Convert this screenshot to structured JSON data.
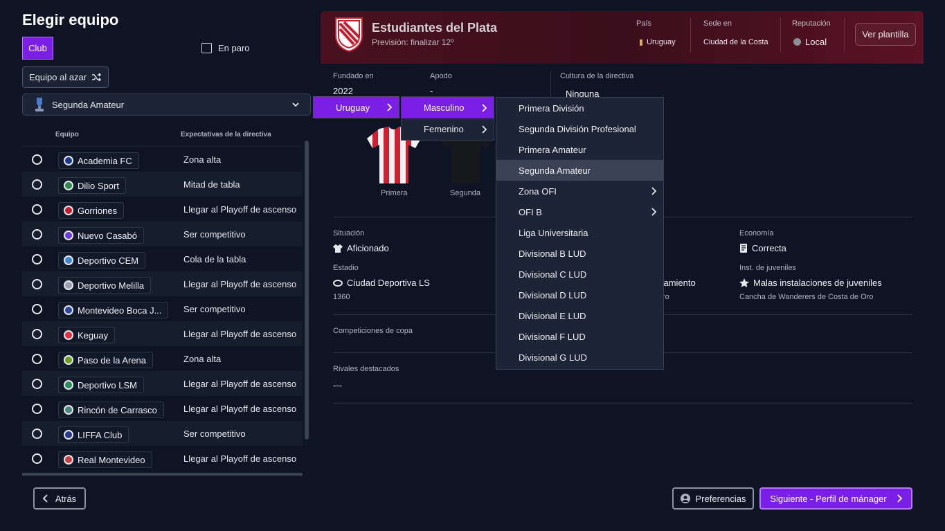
{
  "left": {
    "title": "Elegir equipo",
    "club_tab": "Club",
    "en_paro": "En paro",
    "random_btn": "Equipo al azar",
    "league": "Segunda Amateur",
    "col_team": "Equipo",
    "col_expect": "Expectativas de la directiva",
    "rows": [
      {
        "name": "Academia FC",
        "expect": "Zona alta",
        "color": "#1a3a8a"
      },
      {
        "name": "Dilio Sport",
        "expect": "Mitad de tabla",
        "color": "#2e8a4a"
      },
      {
        "name": "Gorriones",
        "expect": "Llegar al Playoff de ascenso",
        "color": "#c02030"
      },
      {
        "name": "Nuevo Casabó",
        "expect": "Ser competitivo",
        "color": "#6a3adc"
      },
      {
        "name": "Deportivo CEM",
        "expect": "Cola de la tabla",
        "color": "#3a8ad8"
      },
      {
        "name": "Deportivo Melilla",
        "expect": "Llegar al Playoff de ascenso",
        "color": "#9aa0b0"
      },
      {
        "name": "Montevideo Boca J...",
        "expect": "Ser competitivo",
        "color": "#2a4aa8"
      },
      {
        "name": "Keguay",
        "expect": "Llegar al Playoff de ascenso",
        "color": "#e03040"
      },
      {
        "name": "Paso de la Arena",
        "expect": "Zona alta",
        "color": "#6aa020"
      },
      {
        "name": "Deportivo LSM",
        "expect": "Llegar al Playoff de ascenso",
        "color": "#2a8a5a"
      },
      {
        "name": "Rincón de Carrasco",
        "expect": "Llegar al Playoff de ascenso",
        "color": "#4a8a7a"
      },
      {
        "name": "LIFFA Club",
        "expect": "Ser competitivo",
        "color": "#2a3a8a"
      },
      {
        "name": "Real Montevideo",
        "expect": "Llegar al Playoff de ascenso",
        "color": "#c84040"
      }
    ],
    "back": "Atrás"
  },
  "header": {
    "club_name": "Estudiantes del Plata",
    "prevision": "Previsión: finalizar 12º",
    "pais_label": "País",
    "pais": "Uruguay",
    "sede_label": "Sede en",
    "sede": "Ciudad de la Costa",
    "rep_label": "Reputación",
    "rep": "Local",
    "ver_plantilla": "Ver plantilla"
  },
  "details": {
    "fundado_label": "Fundado en",
    "fundado": "2022",
    "apodo_label": "Apodo",
    "apodo": "-",
    "cultura_label": "Cultura de la directiva",
    "cultura": "Ninguna",
    "shirt1": "Primera",
    "shirt2": "Segunda",
    "situacion_label": "Situación",
    "situacion": "Aficionado",
    "economia_label": "Economía",
    "economia": "Correcta",
    "estadio_label": "Estadio",
    "estadio": "Ciudad Deportiva LS",
    "capacidad": "1360",
    "entreno_partial": "enamiento",
    "entreno_sub_partial": "ro",
    "juveniles_label": "Inst. de juveniles",
    "juveniles": "Malas instalaciones de juveniles",
    "juveniles_sub": "Cancha de Wanderers de Costa de Oro",
    "copa_label": "Competiciones de copa",
    "rivales_label": "Rivales destacados",
    "rivales": "---"
  },
  "menus": {
    "country": "Uruguay",
    "genders": [
      "Masculino",
      "Femenino"
    ],
    "leagues": [
      {
        "name": "Primera División",
        "sub": false
      },
      {
        "name": "Segunda División Profesional",
        "sub": false
      },
      {
        "name": "Primera Amateur",
        "sub": false
      },
      {
        "name": "Segunda Amateur",
        "sub": false
      },
      {
        "name": "Zona OFI",
        "sub": true
      },
      {
        "name": "OFI B",
        "sub": true
      },
      {
        "name": "Liga Universitaria",
        "sub": false
      },
      {
        "name": "Divisional B LUD",
        "sub": false
      },
      {
        "name": "Divisional C LUD",
        "sub": false
      },
      {
        "name": "Divisional D LUD",
        "sub": false
      },
      {
        "name": "Divisional E LUD",
        "sub": false
      },
      {
        "name": "Divisional F LUD",
        "sub": false
      },
      {
        "name": "Divisional G LUD",
        "sub": false
      }
    ]
  },
  "footer": {
    "preferencias": "Preferencias",
    "siguiente": "Siguiente - Perfil de mánager"
  },
  "colors": {
    "accent": "#7b1fe6",
    "header_bg": "#4a1020",
    "bg": "#0e1424"
  }
}
